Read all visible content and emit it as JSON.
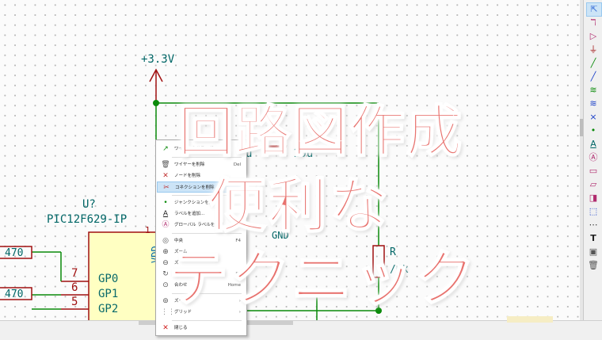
{
  "title_overlay": {
    "line1": "回路図作成",
    "line2": "便利な",
    "line3": "テクニック",
    "color": "#e8736f"
  },
  "schematic": {
    "power_label": "+3.3V",
    "ref": "U?",
    "part": "PIC12F629-IP",
    "pins": [
      {
        "num": "7",
        "name": "GP0"
      },
      {
        "num": "6",
        "name": "GP1"
      },
      {
        "num": "5",
        "name": "GP2"
      }
    ],
    "pin1": "1",
    "vdd_label": "VDD",
    "resistor_values": [
      "470",
      "470"
    ],
    "cap_left_value": "u",
    "cap_value": "10u",
    "gnd_partial": "GND",
    "right_res_ref": "R",
    "right_res_value": "/0k",
    "wire_color": "#0a8a0a",
    "part_color": "#a01010",
    "label_color": "#006666"
  },
  "context_menu": {
    "items": [
      {
        "label": "ワイヤーをドラッグ",
        "shortcut": "G",
        "icon": "drag-wire-icon"
      },
      {
        "label": "ワイヤーを削除",
        "shortcut": "Del",
        "icon": "delete-wire-icon"
      },
      {
        "label": "ノードを削除",
        "shortcut": "",
        "icon": "delete-node-icon"
      },
      {
        "label": "コネクションを削除",
        "shortcut": "",
        "icon": "delete-connection-icon",
        "highlighted": true
      },
      {
        "label": "ジャンクションを追加",
        "shortcut": "",
        "icon": "add-junction-icon"
      },
      {
        "label": "ラベルを追加...",
        "shortcut": "",
        "icon": "add-label-icon"
      },
      {
        "label": "グローバル ラベルを追加...",
        "shortcut": "",
        "icon": "add-global-label-icon"
      },
      {
        "label": "中央",
        "shortcut": "F4",
        "icon": "center-icon"
      },
      {
        "label": "ズーム",
        "shortcut": "",
        "icon": "zoom-in-icon"
      },
      {
        "label": "ズ",
        "shortcut": "",
        "icon": "zoom-out-icon"
      },
      {
        "label": "ビューを再描画",
        "shortcut": "F3",
        "icon": "redraw-icon"
      },
      {
        "label": "合わせ",
        "shortcut": "Home",
        "icon": "zoom-fit-icon"
      },
      {
        "label": "ズーム",
        "shortcut": "›",
        "icon": "zoom-select-icon"
      },
      {
        "label": "グリッド",
        "shortcut": "›",
        "icon": "grid-icon"
      },
      {
        "label": "閉じる",
        "shortcut": "",
        "icon": "close-icon"
      }
    ]
  },
  "right_toolbar": {
    "icons": [
      "select-icon",
      "highlight-net-icon",
      "add-symbol-icon",
      "add-power-icon",
      "add-power-gnd-icon",
      "add-wire-icon",
      "add-bus-icon",
      "add-bus-entry-icon",
      "add-wire-entry-icon",
      "no-connect-icon",
      "add-junction-icon",
      "add-label-icon",
      "add-global-label-icon",
      "add-hier-label-icon",
      "add-sheet-icon",
      "import-sheet-pin-icon",
      "add-sheet-pin-icon",
      "add-line-icon",
      "add-text-icon",
      "add-image-icon",
      "delete-icon"
    ]
  }
}
